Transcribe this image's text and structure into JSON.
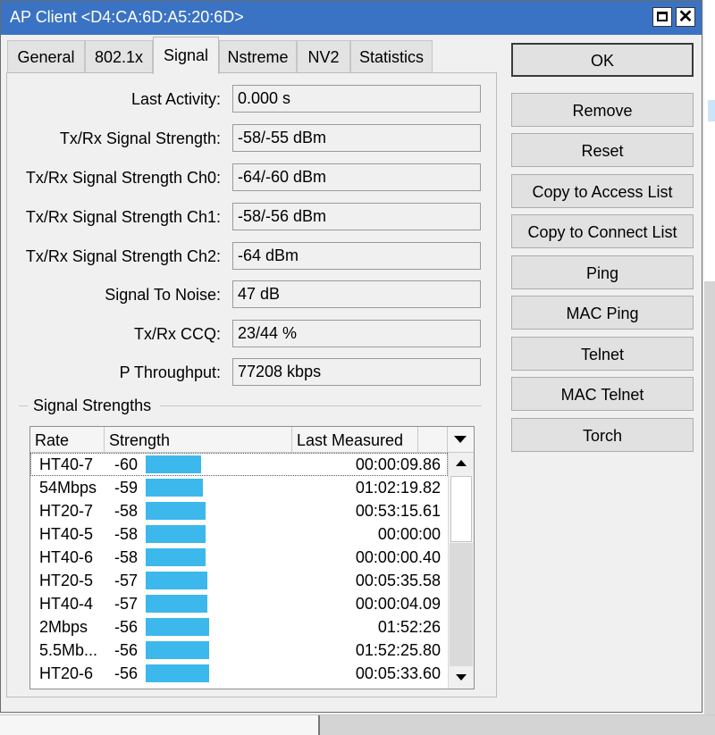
{
  "window": {
    "title": "AP Client <D4:CA:6D:A5:20:6D>",
    "colors": {
      "titlebar": "#3a73c4",
      "bar": "#3cb8ec"
    },
    "controls": {
      "maximize_icon": "maximize-icon",
      "close_icon": "close-icon",
      "close_glyph": "✕"
    }
  },
  "tabs": [
    {
      "label": "General"
    },
    {
      "label": "802.1x"
    },
    {
      "label": "Signal",
      "active": true
    },
    {
      "label": "Nstreme"
    },
    {
      "label": "NV2"
    },
    {
      "label": "Statistics"
    }
  ],
  "fields": [
    {
      "label": "Last Activity:",
      "value": "0.000 s"
    },
    {
      "label": "Tx/Rx Signal Strength:",
      "value": "-58/-55 dBm"
    },
    {
      "label": "Tx/Rx Signal Strength Ch0:",
      "value": "-64/-60 dBm"
    },
    {
      "label": "Tx/Rx Signal Strength Ch1:",
      "value": "-58/-56 dBm"
    },
    {
      "label": "Tx/Rx Signal Strength Ch2:",
      "value": "-64 dBm"
    },
    {
      "label": "Signal To Noise:",
      "value": "47 dB"
    },
    {
      "label": "Tx/Rx CCQ:",
      "value": "23/44 %"
    },
    {
      "label": "P Throughput:",
      "value": "77208 kbps"
    }
  ],
  "signal_group": {
    "title": "Signal Strengths",
    "columns": [
      "Rate",
      "Strength",
      "Last Measured"
    ],
    "rows": [
      {
        "rate": "HT40-7",
        "strength": "-60",
        "last": "00:00:09.86"
      },
      {
        "rate": "54Mbps",
        "strength": "-59",
        "last": "01:02:19.82"
      },
      {
        "rate": "HT20-7",
        "strength": "-58",
        "last": "00:53:15.61"
      },
      {
        "rate": "HT40-5",
        "strength": "-58",
        "last": "00:00:00"
      },
      {
        "rate": "HT40-6",
        "strength": "-58",
        "last": "00:00:00.40"
      },
      {
        "rate": "HT20-5",
        "strength": "-57",
        "last": "00:05:35.58"
      },
      {
        "rate": "HT40-4",
        "strength": "-57",
        "last": "00:00:04.09"
      },
      {
        "rate": "2Mbps",
        "strength": "-56",
        "last": "01:52:26"
      },
      {
        "rate": "5.5Mb...",
        "strength": "-56",
        "last": "01:52:25.80"
      },
      {
        "rate": "HT20-6",
        "strength": "-56",
        "last": "00:05:33.60"
      }
    ]
  },
  "buttons": [
    {
      "label": "OK",
      "primary": true
    },
    {
      "label": "Remove"
    },
    {
      "label": "Reset"
    },
    {
      "label": "Copy to Access List"
    },
    {
      "label": "Copy to Connect List"
    },
    {
      "label": "Ping"
    },
    {
      "label": "MAC Ping"
    },
    {
      "label": "Telnet"
    },
    {
      "label": "MAC Telnet"
    },
    {
      "label": "Torch"
    }
  ]
}
